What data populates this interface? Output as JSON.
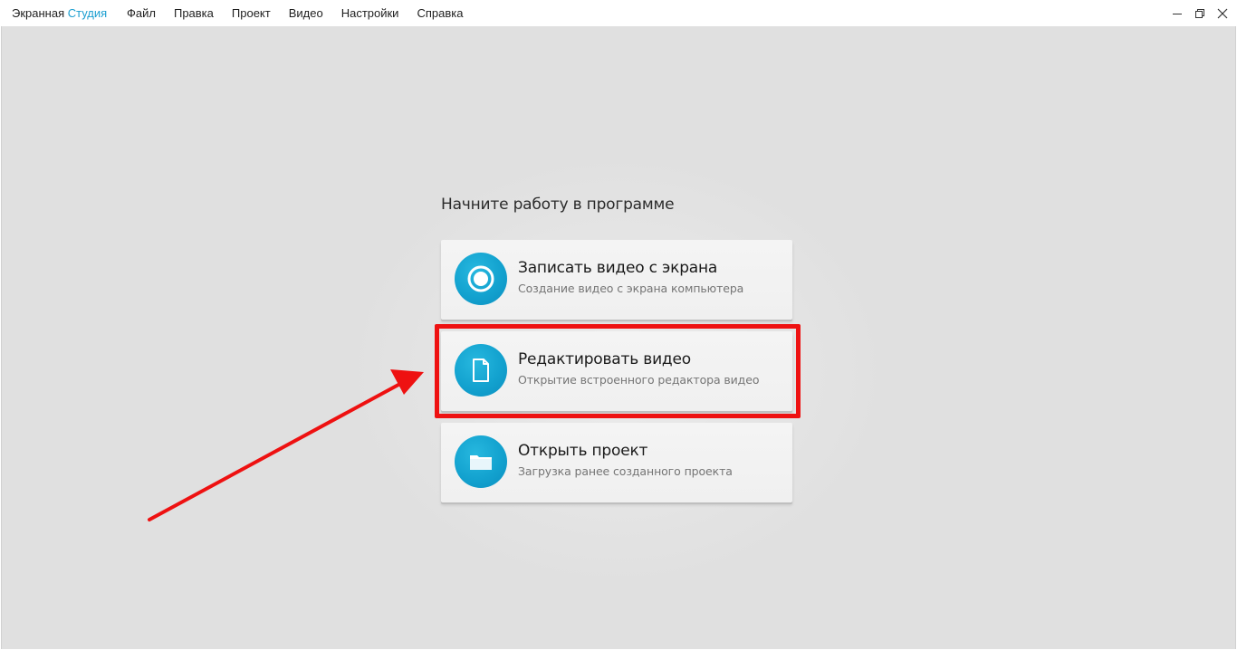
{
  "app": {
    "name_part1": "Экранная",
    "name_part2": "Студия"
  },
  "menu": {
    "items": [
      {
        "label": "Файл"
      },
      {
        "label": "Правка"
      },
      {
        "label": "Проект"
      },
      {
        "label": "Видео"
      },
      {
        "label": "Настройки"
      },
      {
        "label": "Справка"
      }
    ]
  },
  "window_controls": {
    "minimize_icon": "minimize-icon",
    "restore_icon": "restore-icon",
    "close_icon": "close-icon"
  },
  "start": {
    "heading": "Начните работу в программе",
    "cards": [
      {
        "title": "Записать видео с экрана",
        "subtitle": "Создание видео с экрана компьютера",
        "icon": "record-icon"
      },
      {
        "title": "Редактировать видео",
        "subtitle": "Открытие встроенного редактора видео",
        "icon": "document-icon"
      },
      {
        "title": "Открыть проект",
        "subtitle": "Загрузка ранее созданного проекта",
        "icon": "folder-icon"
      }
    ]
  },
  "colors": {
    "accent": "#1a9ed0",
    "icon_circle": "#13a2cf",
    "annotation_red": "#ee1111",
    "background": "#e2e2e2"
  }
}
